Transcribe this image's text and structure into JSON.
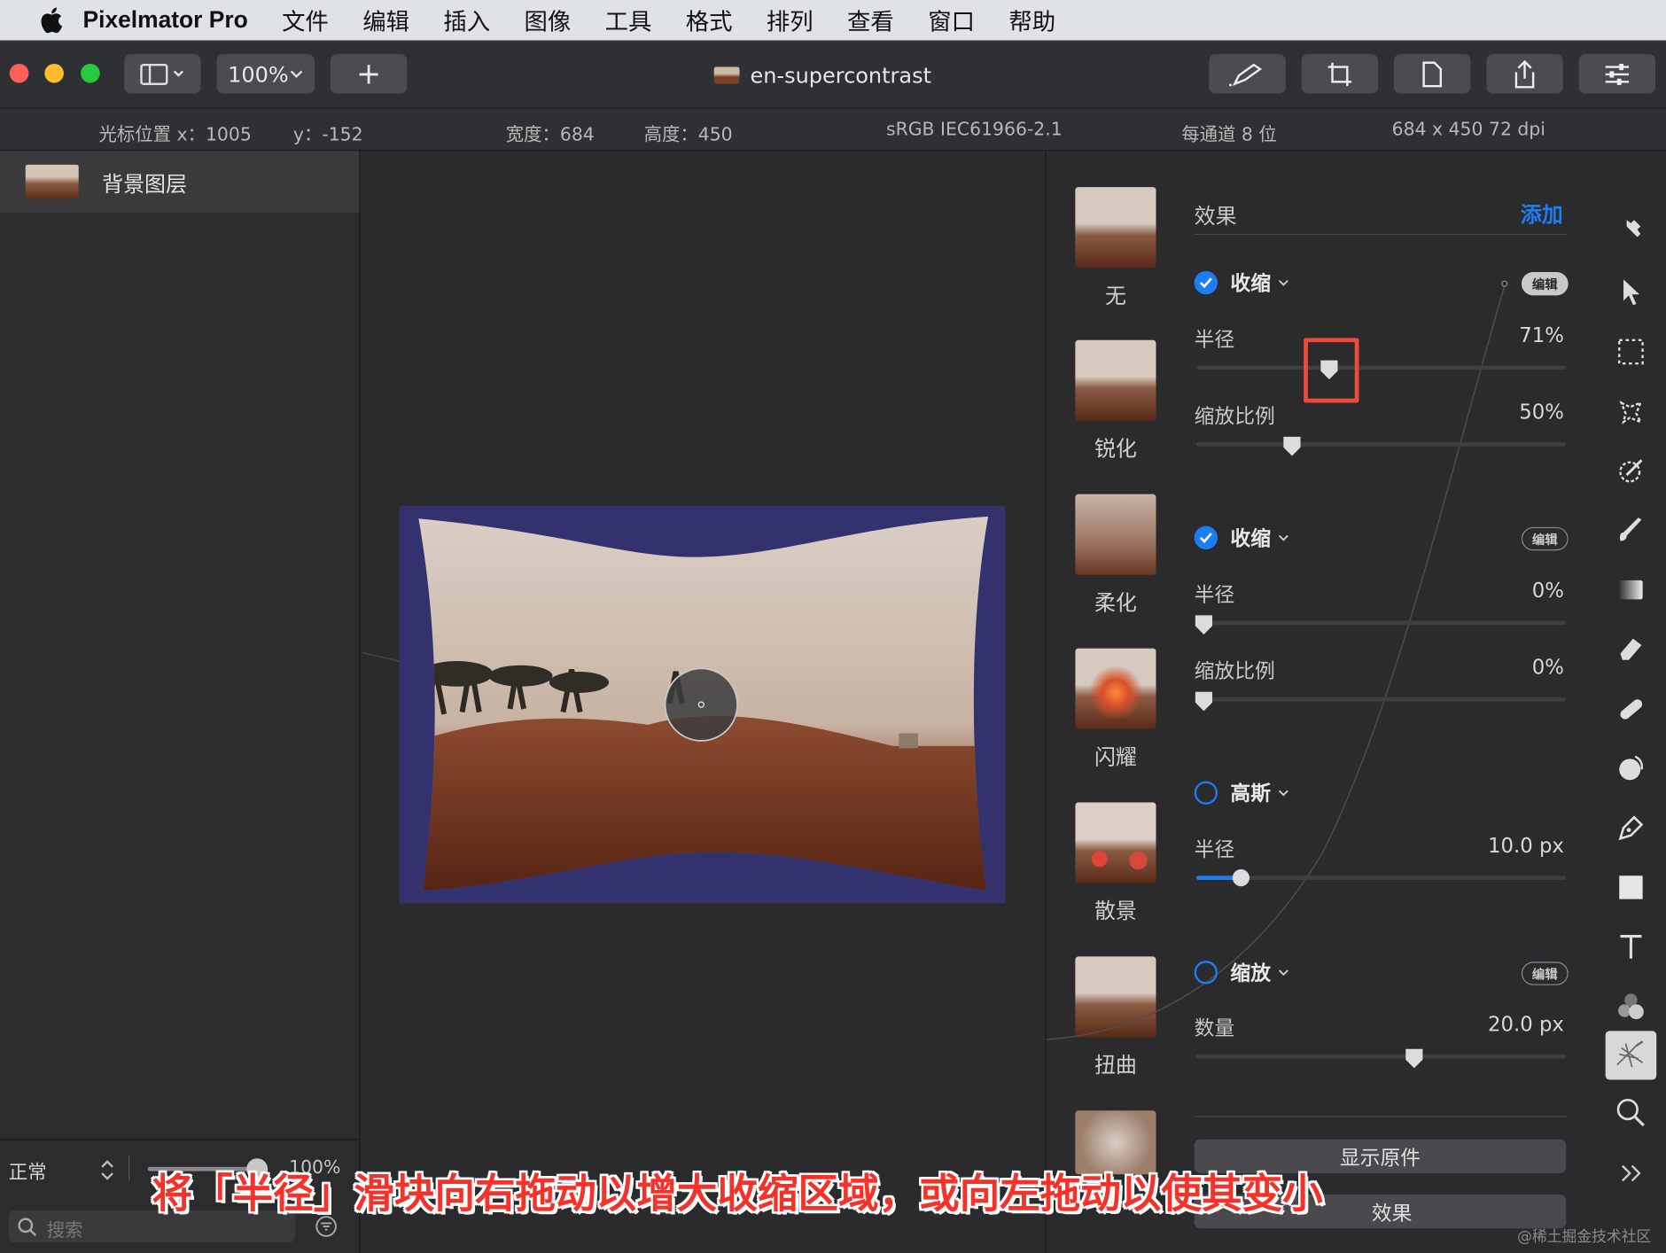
{
  "menubar": {
    "app_name": "Pixelmator Pro",
    "items": [
      "文件",
      "编辑",
      "插入",
      "图像",
      "工具",
      "格式",
      "排列",
      "查看",
      "窗口",
      "帮助"
    ]
  },
  "toolbar": {
    "zoom_label": "100%",
    "add_label": "+",
    "document_title": "en-supercontrast"
  },
  "infobar": {
    "cursor_x": "光标位置 x：1005",
    "cursor_y": "y：-152",
    "width": "宽度：684",
    "height": "高度：450",
    "profile": "sRGB IEC61966-2.1",
    "depth": "每通道 8 位",
    "resolution": "684 x 450 72 dpi"
  },
  "layers": {
    "layer_name": "背景图层",
    "blend_mode": "正常",
    "opacity": "100%",
    "search_placeholder": "搜索"
  },
  "categories": [
    "无",
    "锐化",
    "柔化",
    "闪耀",
    "散景",
    "扭曲"
  ],
  "effects": {
    "header": "效果",
    "add_label": "添加",
    "edit_label": "编辑",
    "pinch1": {
      "name": "收缩",
      "enabled": true,
      "radius_label": "半径",
      "radius_value": "71%",
      "radius_level": 0.36,
      "scale_label": "缩放比例",
      "scale_value": "50%",
      "scale_level": 0.26
    },
    "pinch2": {
      "name": "收缩",
      "enabled": true,
      "radius_label": "半径",
      "radius_value": "0%",
      "radius_level": 0.02,
      "scale_label": "缩放比例",
      "scale_value": "0%",
      "scale_level": 0.02
    },
    "gauss": {
      "name": "高斯",
      "enabled": false,
      "radius_label": "半径",
      "radius_value": "10.0 px",
      "radius_level": 0.12
    },
    "zoom": {
      "name": "缩放",
      "enabled": false,
      "amount_label": "数量",
      "amount_value": "20.0 px",
      "amount_level": 0.59
    },
    "show_original": "显示原件",
    "reset_partial": "效果"
  },
  "caption": "将「半径」滑块向右拖动以增大收缩区域，或向左拖动以使其变小",
  "watermark": "@稀土掘金技术社区",
  "colors": {
    "accent": "#1e7cf2",
    "highlight": "#f04a3a",
    "caption": "#f4322a",
    "canvas_bg": "#33326e"
  }
}
